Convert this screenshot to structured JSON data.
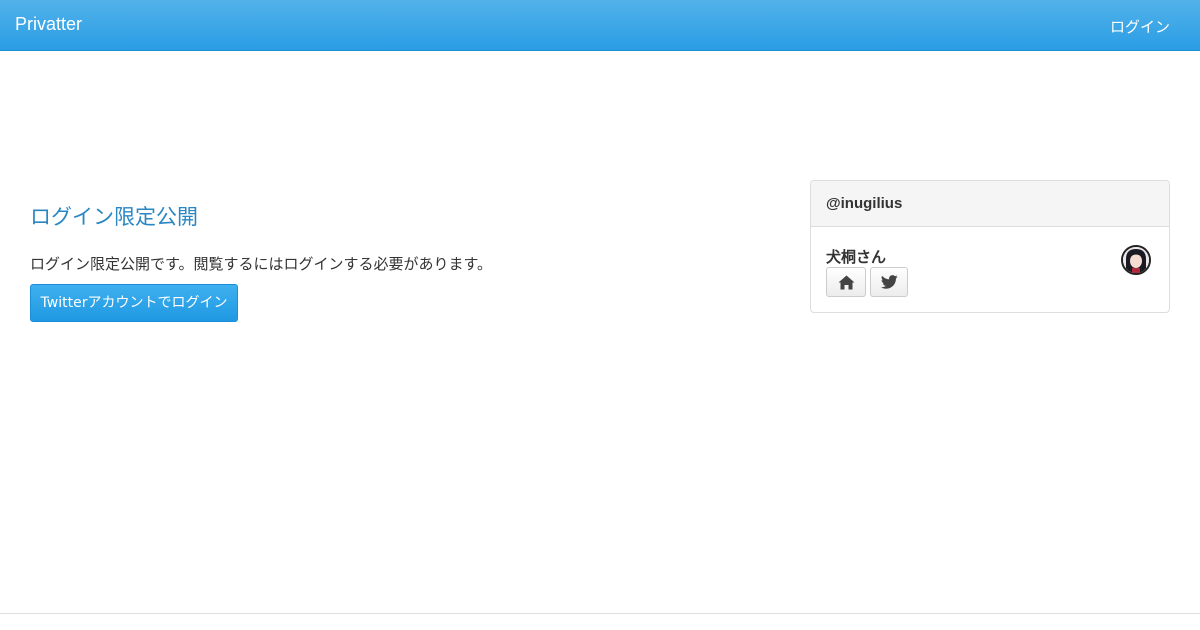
{
  "navbar": {
    "brand": "Privatter",
    "login_link": "ログイン"
  },
  "main": {
    "title": "ログイン限定公開",
    "description": "ログイン限定公開です。閲覧するにはログインする必要があります。",
    "login_button": "Twitterアカウントでログイン"
  },
  "profile_card": {
    "handle": "@inugilius",
    "display_name": "犬桐さん",
    "buttons": [
      "home-icon",
      "twitter-icon"
    ]
  },
  "colors": {
    "navbar": "#2a9de4",
    "title_link": "#2a87c4",
    "button": "#1f98e2"
  }
}
